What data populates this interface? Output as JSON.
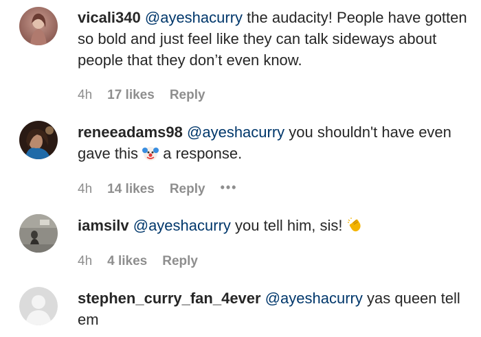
{
  "comments": [
    {
      "username": "vicali340",
      "mention": "@ayeshacurry",
      "text": " the audacity! People have gotten so bold and just feel like they can talk sideways about people that they don’t even know.",
      "time": "4h",
      "likes": "17 likes",
      "reply": "Reply"
    },
    {
      "username": "reneeadams98",
      "mention": "@ayeshacurry",
      "text_before": " you shouldn't have even gave this ",
      "emoji": "clown-face-emoji",
      "text_after": " a response.",
      "time": "4h",
      "likes": "14 likes",
      "reply": "Reply",
      "more": "•••"
    },
    {
      "username": "iamsilv",
      "mention": "@ayeshacurry",
      "text": " you tell him, sis! ",
      "emoji": "clapping-hands-emoji",
      "time": "4h",
      "likes": "4 likes",
      "reply": "Reply"
    },
    {
      "username": "stephen_curry_fan_4ever",
      "mention": "@ayeshacurry",
      "text": " yas queen tell em"
    }
  ],
  "colors": {
    "text": "#262626",
    "mention": "#00376b",
    "meta": "#8e8e8e",
    "background": "#ffffff"
  }
}
